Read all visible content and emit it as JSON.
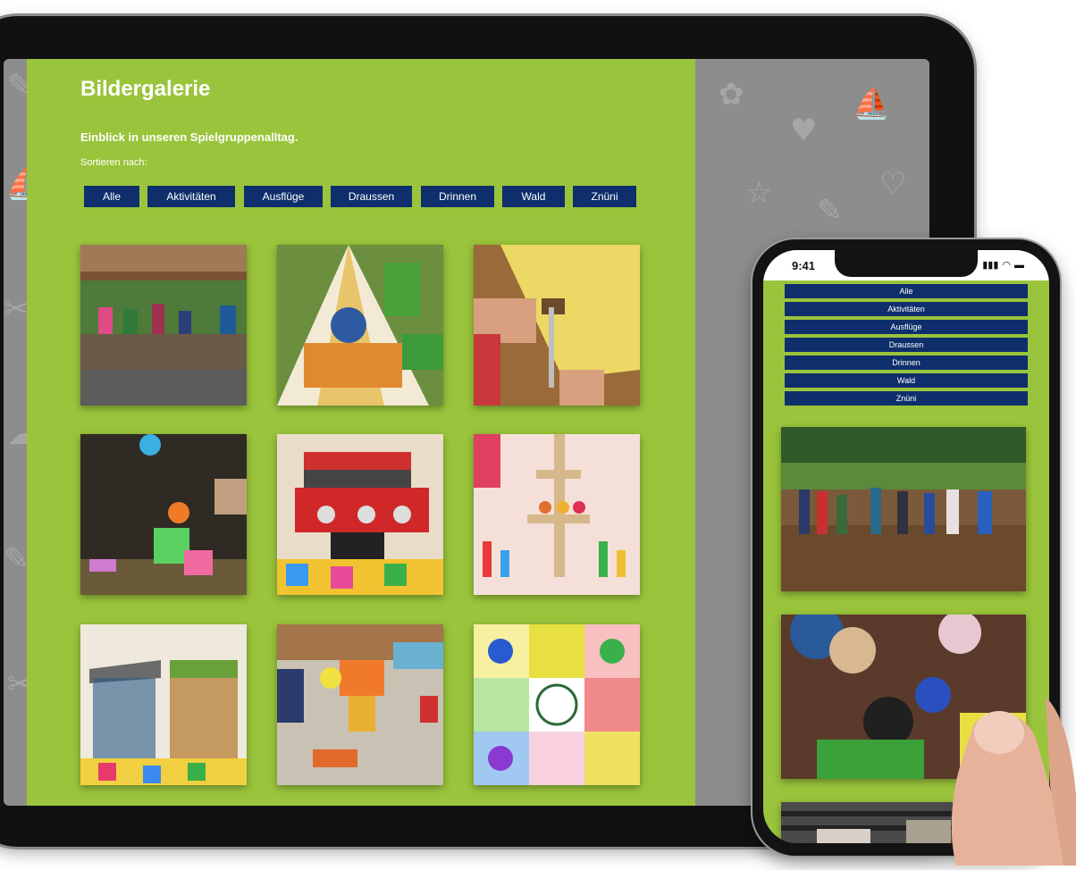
{
  "gallery": {
    "title": "Bildergalerie",
    "subtitle": "Einblick in unseren Spielgruppenalltag.",
    "sort_label": "Sortieren nach:",
    "filters": [
      "Alle",
      "Aktivitäten",
      "Ausflüge",
      "Draussen",
      "Drinnen",
      "Wald",
      "Znüni"
    ],
    "tiles": [
      {
        "subject": "children-at-forest-shelter"
      },
      {
        "subject": "indian-teepee-tent"
      },
      {
        "subject": "child-cutting-with-knife"
      },
      {
        "subject": "sandbox-toys"
      },
      {
        "subject": "toy-kitchen-grill"
      },
      {
        "subject": "wooden-stacking-toys"
      },
      {
        "subject": "play-market-stand"
      },
      {
        "subject": "playroom-chairs-balloon"
      },
      {
        "subject": "handprint-quilt"
      }
    ]
  },
  "phone": {
    "status_time": "9:41",
    "filters": [
      "Alle",
      "Aktivitäten",
      "Ausflüge",
      "Draussen",
      "Drinnen",
      "Wald",
      "Znüni"
    ],
    "tiles": [
      {
        "subject": "children-holding-hands-forest-clearing"
      },
      {
        "subject": "children-top-down-forest-floor"
      },
      {
        "subject": "campfire-grill"
      }
    ]
  },
  "colors": {
    "page_green": "#9ac43b",
    "button_navy": "#0e2f6b",
    "background_gray": "#8d8d8d"
  }
}
